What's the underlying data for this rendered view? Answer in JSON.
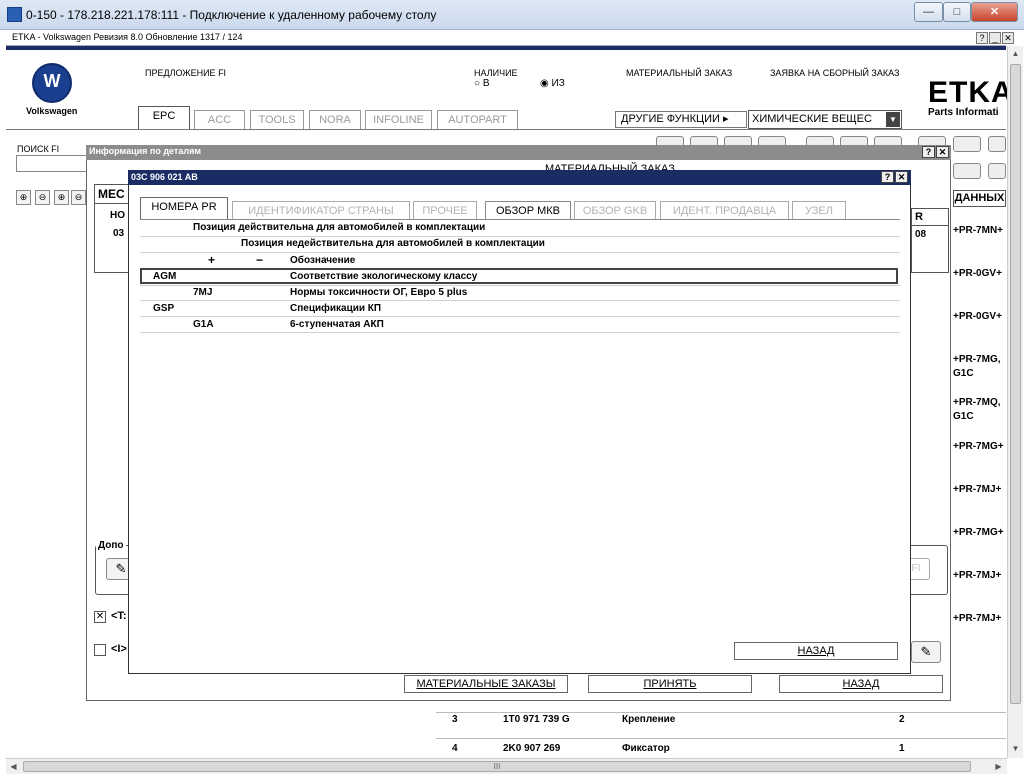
{
  "window": {
    "title": "0-150 - 178.218.221.178:111 - Подключение к удаленному рабочему столу",
    "min": "—",
    "max": "□",
    "close": "✕"
  },
  "app": {
    "bar_title": "ETKA - Volkswagen Ревизия 8.0 Обновление 1317 / 124",
    "help": "?",
    "minimize": "_",
    "close": "✕"
  },
  "header": {
    "brand": "Volkswagen",
    "offer_label": "ПРЕДЛОЖЕНИЕ FI",
    "availability_label": "НАЛИЧИЕ",
    "availability_in": "В",
    "availability_from": "ИЗ",
    "material_order": "МАТЕРИАЛЬНЫЙ ЗАКАЗ",
    "assembly_order": "ЗАЯВКА НА СБОРНЫЙ ЗАКАЗ",
    "etka_logo": "ETKA",
    "etka_sub": "Parts Informati",
    "other_functions": "ДРУГИЕ ФУНКЦИИ",
    "chem_select": "ХИМИЧЕСКИЕ ВЕЩЕС"
  },
  "tabs": [
    "EPC",
    "ACC",
    "TOOLS",
    "NORA",
    "INFOLINE",
    "AUTOPART"
  ],
  "search": {
    "label": "ПОИСК FI",
    "value": ""
  },
  "right_column": {
    "header": "ДАННЫХ",
    "cells": [
      "+PR-7MN+",
      "+PR-0GV+",
      "+PR-0GV+",
      "+PR-7MG,",
      "G1C",
      "+PR-7MQ,",
      "G1C",
      "+PR-7MG+",
      "+PR-7MJ+",
      "+PR-7MG+",
      "+PR-7MJ+",
      "+PR-7MJ+"
    ]
  },
  "bottom_rows": [
    {
      "pos": "3",
      "part": "1T0 971 739 G",
      "name": "Крепление",
      "qty": "2"
    },
    {
      "pos": "4",
      "part": "2K0 907 269",
      "name": "Фиксатор",
      "qty": "1"
    }
  ],
  "outer_dialog": {
    "title": "Информация по деталям",
    "heading": "МАТЕРИАЛЬНЫЙ ЗАКАЗ",
    "tab_mes": "МЕС",
    "col_no": "НО",
    "row_no": "03",
    "col_r": "R",
    "row_r": "08",
    "dop_label": "Допо",
    "check1_label": "<T:",
    "check2_label": "<I>",
    "fi_btn": "FI",
    "btn_material_orders": "МАТЕРИАЛЬНЫЕ ЗАКАЗЫ",
    "btn_accept": "ПРИНЯТЬ",
    "btn_back": "НАЗАД"
  },
  "inner_dialog": {
    "title": "03C 906 021 AB",
    "tabs": [
      "НОМЕРА PR",
      "ИДЕНТИФИКАТОР СТРАНЫ",
      "ПРОЧЕЕ",
      "ОБЗОР МКВ",
      "ОБЗОР GKB",
      "ИДЕНТ. ПРОДАВЦА",
      "УЗЕЛ"
    ],
    "header_valid": "Позиция действительна для автомобилей в комплектации",
    "header_invalid": "Позиция недействительна для автомобилей в комплектации",
    "col_plus": "+",
    "col_minus": "−",
    "col_designation": "Обозначение",
    "rows": [
      {
        "code": "AGM",
        "sub": "",
        "desc": "Соответствие экологическому классу"
      },
      {
        "code": "",
        "sub": "7MJ",
        "desc": "Нормы токсичности ОГ, Евро 5 plus"
      },
      {
        "code": "GSP",
        "sub": "",
        "desc": "Спецификации КП"
      },
      {
        "code": "",
        "sub": "G1A",
        "desc": "6-ступенчатая АКП"
      }
    ],
    "btn_back": "НАЗАД"
  },
  "scrollbar": {
    "grip": "III"
  }
}
